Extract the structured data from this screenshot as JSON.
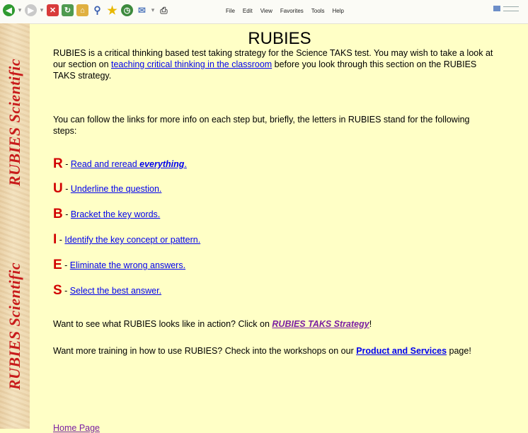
{
  "browser": {
    "menu": [
      "File",
      "Edit",
      "View",
      "Favorites",
      "Tools",
      "Help"
    ]
  },
  "banner": {
    "text_top": "RUBIES  Scientific",
    "text_bottom": "RUBIES  Scientific"
  },
  "page": {
    "title": "RUBIES",
    "intro_before": "RUBIES is a critical thinking based test taking strategy for the Science TAKS test.  You may wish to take a look at our section on ",
    "intro_link": "teaching critical thinking in the classroom",
    "intro_after": " before you look through this section on the RUBIES TAKS strategy.",
    "follow_text": "You can follow the links for more info on each step but, briefly, the letters in RUBIES stand for the following steps:",
    "steps": [
      {
        "letter": "R",
        "sep": " - ",
        "link": "Read and reread ",
        "emph": "everything",
        "end": "."
      },
      {
        "letter": "U",
        "sep": " - ",
        "link": "Underline the question."
      },
      {
        "letter": "B",
        "sep": " - ",
        "link": "Bracket the key words."
      },
      {
        "letter": "I",
        "sep": " - ",
        "link": "Identify the key concept or pattern."
      },
      {
        "letter": "E",
        "sep": " - ",
        "link": "Eliminate the wrong answers."
      },
      {
        "letter": "S",
        "sep": " - ",
        "link": "Select the best answer."
      }
    ],
    "action_before": "Want to see what RUBIES looks like in action? Click on ",
    "action_link": "RUBIES TAKS Strategy",
    "action_after": "!",
    "training_before": "Want more training in how to use RUBIES? Check into the workshops on our ",
    "training_link": "Product and Services",
    "training_after": " page!",
    "home_link": "Home Page"
  },
  "colors": {
    "background": "#ffffc6",
    "letter_red": "#d10000",
    "banner_text": "#c81b1b"
  }
}
